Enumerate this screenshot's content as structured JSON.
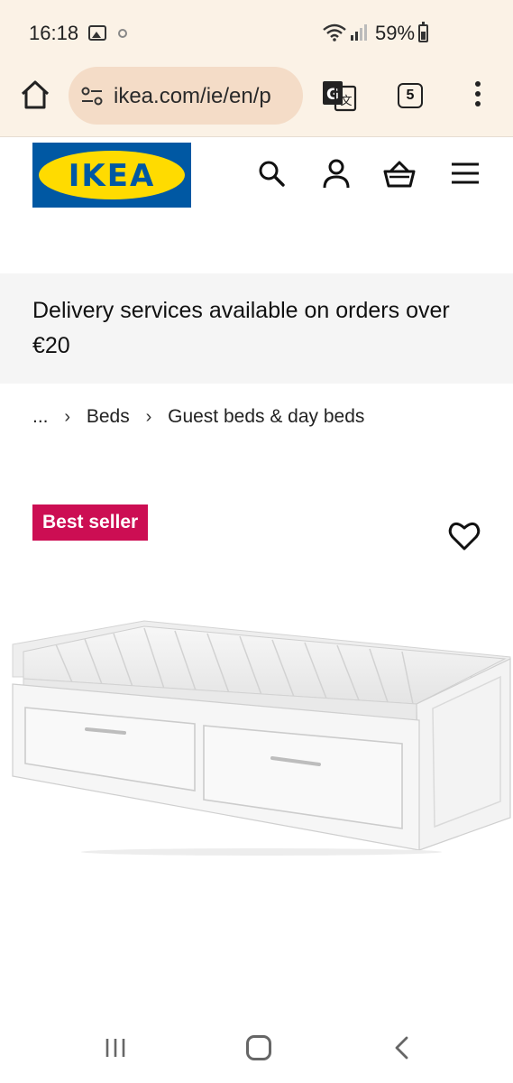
{
  "status_bar": {
    "time": "16:18",
    "battery": "59%"
  },
  "browser": {
    "url": "ikea.com/ie/en/p",
    "tab_count": "5"
  },
  "site": {
    "logo_text": "IKEA",
    "brand_colors": {
      "blue": "#0058a3",
      "yellow": "#ffdb00"
    }
  },
  "header_icons": [
    "search-icon",
    "user-icon",
    "basket-icon",
    "hamburger-menu-icon"
  ],
  "banner": {
    "text": "Delivery services available on orders over €20"
  },
  "breadcrumb": {
    "items": [
      "...",
      "Beds",
      "Guest beds & day beds"
    ]
  },
  "product": {
    "badge": "Best seller",
    "badge_color": "#cc0e53"
  }
}
